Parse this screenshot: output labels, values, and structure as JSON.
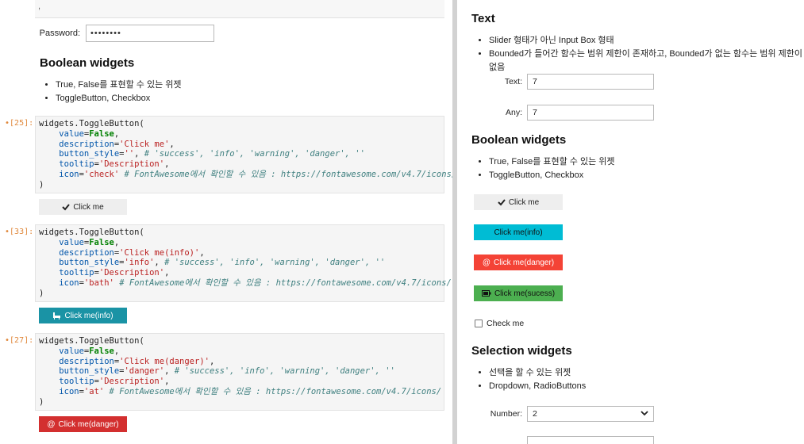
{
  "left": {
    "password": {
      "label": "Password:",
      "value": "••••••••"
    },
    "boolean_heading": "Boolean widgets",
    "boolean_bullets": [
      "True, False를 표현할 수 있는 위젯",
      "ToggleButton, Checkbox"
    ],
    "cells": [
      {
        "prompt": "[25]:",
        "style_value": "''",
        "description": "'Click me'",
        "icon_value": "'check'",
        "button_label": "Click me",
        "button_icon": "check-icon"
      },
      {
        "prompt": "[33]:",
        "style_value": "'info'",
        "description": "'Click me(info)'",
        "icon_value": "'bath'",
        "button_label": "Click me(info)",
        "button_icon": "bath-icon"
      },
      {
        "prompt": "[27]:",
        "style_value": "'danger'",
        "description": "'Click me(danger)'",
        "icon_value": "'at'",
        "button_label": "Click me(danger)",
        "button_icon": "at-icon"
      }
    ],
    "code_common": {
      "line1": "widgets.ToggleButton(",
      "value_kw": "value",
      "value_val": "False",
      "desc_kw": "description",
      "style_kw": "button_style",
      "style_comment": "# 'success', 'info', 'warning', 'danger', ''",
      "tooltip_kw": "tooltip",
      "tooltip_val": "'Description'",
      "icon_kw": "icon",
      "icon_comment": "# FontAwesome에서 확인할 수 있음 : https://fontawesome.com/v4.7/icons/",
      "close": ")"
    }
  },
  "right": {
    "text_heading": "Text",
    "text_bullets": [
      "Slider 형태가 아닌 Input Box 형태",
      "Bounded가 들어간 함수는 범위 제한이 존재하고, Bounded가 없는 함수는 범위 제한이 없음"
    ],
    "text_field": {
      "label": "Text:",
      "value": "7"
    },
    "any_field": {
      "label": "Any:",
      "value": "7"
    },
    "boolean_heading": "Boolean widgets",
    "boolean_bullets": [
      "True, False를 표현할 수 있는 위젯",
      "ToggleButton, Checkbox"
    ],
    "buttons": [
      {
        "label": "Click me",
        "style": "default",
        "icon": "check-icon"
      },
      {
        "label": "Click me(info)",
        "style": "info",
        "icon": ""
      },
      {
        "label": "Click me(danger)",
        "style": "danger",
        "icon": "at-icon"
      },
      {
        "label": "Click me(sucess)",
        "style": "success",
        "icon": "battery-icon"
      }
    ],
    "checkbox_label": "Check me",
    "selection_heading": "Selection widgets",
    "selection_bullets": [
      "선택을 할 수 있는 위젯",
      "Dropdown, RadioButtons"
    ],
    "number_field": {
      "label": "Number:",
      "value": "2"
    }
  },
  "colors": {
    "info": "#00bcd4",
    "danger": "#f44336",
    "success": "#4caf50",
    "default": "#eeeeee",
    "prompt": "#e0883b"
  }
}
